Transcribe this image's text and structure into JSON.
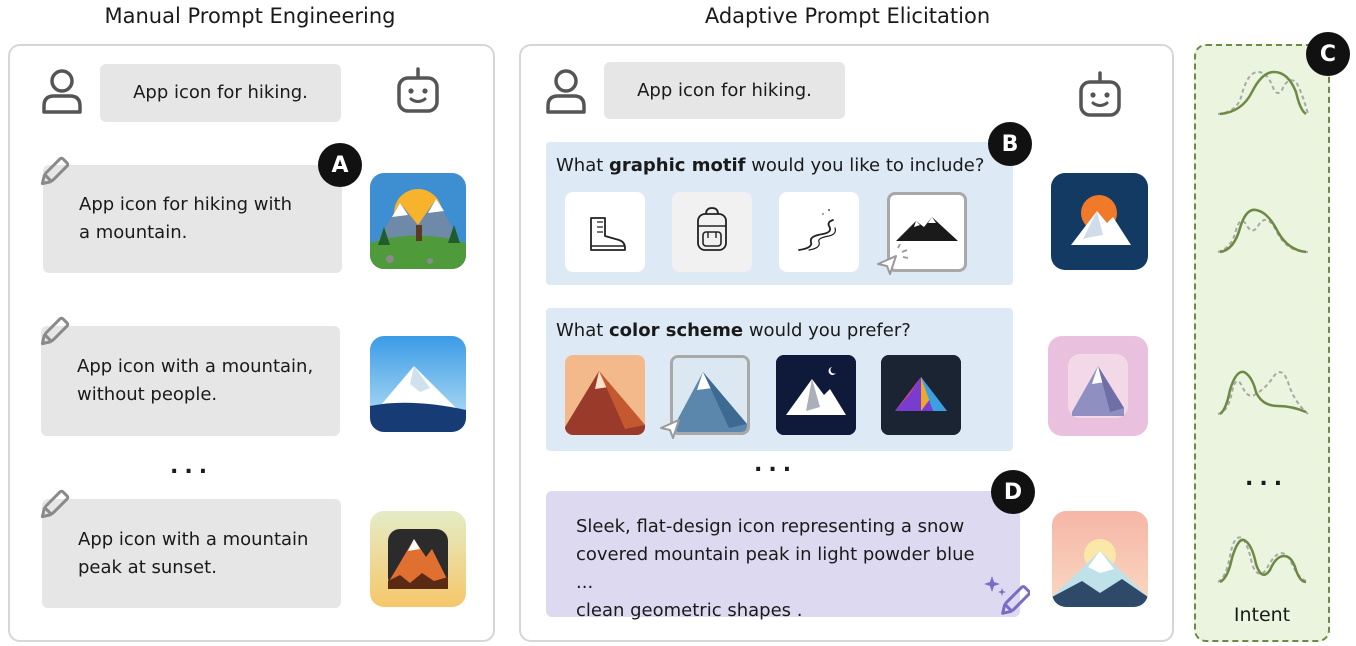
{
  "left": {
    "title": "Manual Prompt Engineering",
    "user_prompt": "App icon for hiking.",
    "badge": "A",
    "refinements": [
      {
        "text": "App icon for hiking with\na mountain."
      },
      {
        "text": "App icon with a mountain,\nwithout people."
      },
      {
        "text": "App icon with a mountain\npeak at sunset."
      }
    ],
    "dots": "..."
  },
  "right": {
    "title": "Adaptive Prompt Elicitation",
    "user_prompt": "App icon for hiking.",
    "badge_b": "B",
    "badge_d": "D",
    "q1": {
      "pre": "What ",
      "bold": "graphic motif",
      "post": " would you like to include?"
    },
    "q2": {
      "pre": "What ",
      "bold": "color scheme",
      "post": " would you prefer?"
    },
    "dots": "...",
    "final_prompt": "Sleek, flat-design icon representing a snow\ncovered mountain peak in light powder blue ...\nclean geometric shapes ."
  },
  "intent": {
    "badge": "C",
    "label": "Intent",
    "dots": "...",
    "line_color": "#6d8a45",
    "dash_color": "#a8a8a8"
  }
}
